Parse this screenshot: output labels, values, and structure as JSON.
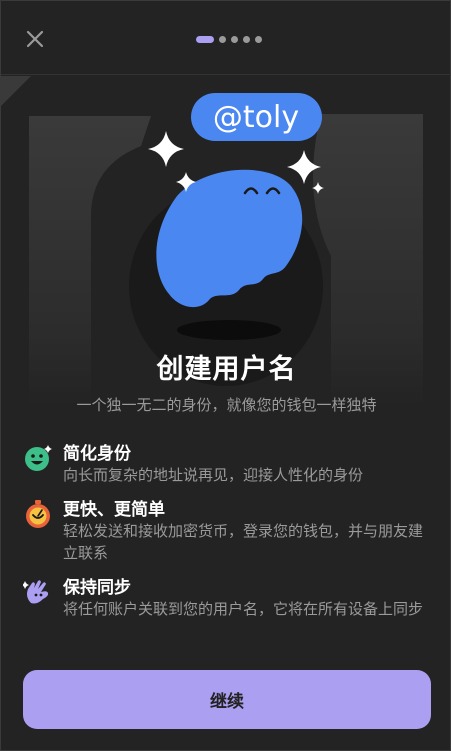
{
  "header": {
    "close_icon": "close-icon",
    "pagination": {
      "total": 5,
      "current": 1
    }
  },
  "hero": {
    "username_tag": "@toly"
  },
  "main": {
    "title": "创建用户名",
    "subtitle": "一个独一无二的身份，就像您的钱包一样独特"
  },
  "features": [
    {
      "icon": "smiley-face-icon",
      "title": "简化身份",
      "description": "向长而复杂的地址说再见，迎接人性化的身份"
    },
    {
      "icon": "stopwatch-icon",
      "title": "更快、更简单",
      "description": "轻松发送和接收加密货币，登录您的钱包，并与朋友建立联系"
    },
    {
      "icon": "waving-hand-icon",
      "title": "保持同步",
      "description": "将任何账户关联到您的用户名，它将在所有设备上同步"
    }
  ],
  "footer": {
    "continue_label": "继续"
  },
  "colors": {
    "accent": "#ab9ff2",
    "ghost_blue": "#4a87f0",
    "background": "#232323"
  }
}
